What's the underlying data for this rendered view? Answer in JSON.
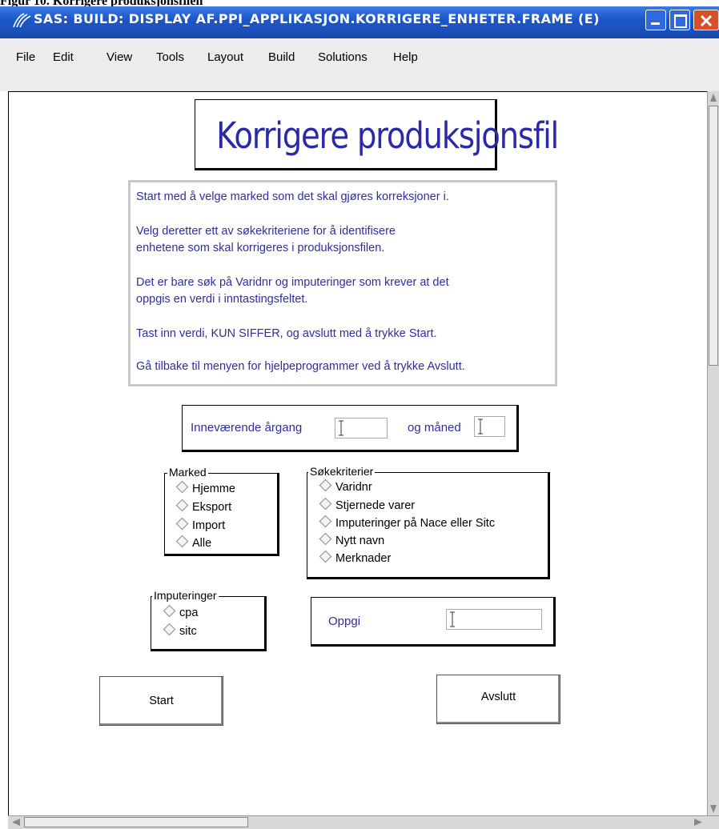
{
  "document_caption": "Figur 10. Korrigere produksjonsfilen",
  "window": {
    "title": "SAS: BUILD: DISPLAY AF.PPI_APPLIKASJON.KORRIGERE_ENHETER.FRAME (E)",
    "icons": [
      "sas-logo-icon",
      "minimize-icon",
      "maximize-icon",
      "close-icon"
    ]
  },
  "menu": [
    "File",
    "Edit",
    "View",
    "Tools",
    "Layout",
    "Build",
    "Solutions",
    "Help"
  ],
  "frame": {
    "heading": "Korrigere produksjonsfil",
    "info_lines": [
      "Start med å velge marked som det skal gjøres korreksjoner i.",
      "Velg deretter ett av søkekriteriene for å identifisere",
      "enhetene som skal korrigeres i produksjonsfilen.",
      "Det er bare søk på Varidnr og imputeringer som krever at det",
      "oppgis en verdi i inntastingsfeltet.",
      "Tast inn verdi, KUN SIFFER, og avslutt med å trykke Start.",
      "Gå tilbake til menyen for hjelpeprogrammer ved å trykke Avslutt."
    ],
    "year_label": "Inneværende årgang",
    "month_label": "og måned",
    "year_value": "",
    "month_value": "",
    "marked": {
      "legend": "Marked",
      "options": [
        "Hjemme",
        "Eksport",
        "Import",
        "Alle"
      ]
    },
    "sokekriterier": {
      "legend": "Søkekriterier",
      "options": [
        "Varidnr",
        "Stjernede varer",
        "Imputeringer på Nace eller Sitc",
        "Nytt navn",
        "Merknader"
      ]
    },
    "imputeringer": {
      "legend": "Imputeringer",
      "options": [
        "cpa",
        "sitc"
      ]
    },
    "oppgi_label": "Oppgi",
    "oppgi_value": "",
    "start_button": "Start",
    "avslutt_button": "Avslutt"
  },
  "colors": {
    "titlebar": "#1d57c8",
    "label_blue": "#2e2e9e",
    "heading_blue": "#2a2aa8"
  }
}
